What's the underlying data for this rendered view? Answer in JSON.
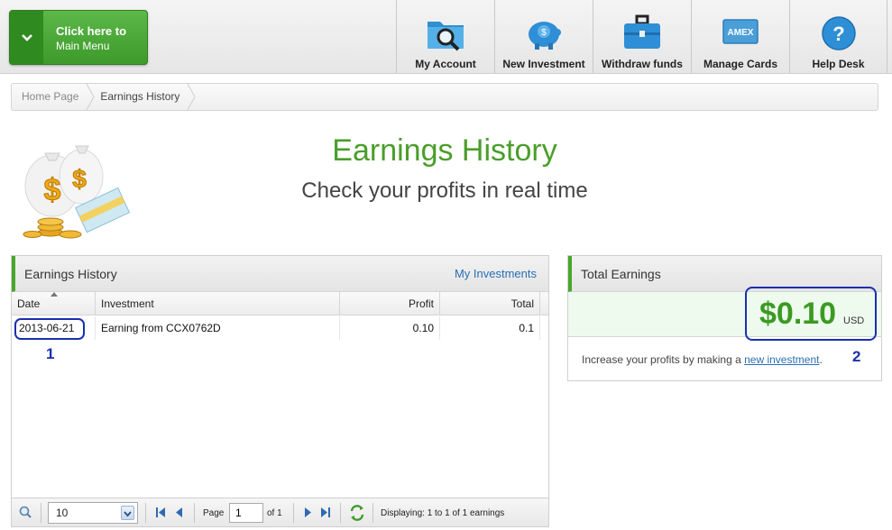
{
  "menu": {
    "line1": "Click here to",
    "line2": "Main Menu"
  },
  "nav": [
    {
      "label": "My Account",
      "icon": "magnifier-folder-icon"
    },
    {
      "label": "New Investment",
      "icon": "piggy-bank-icon"
    },
    {
      "label": "Withdraw funds",
      "icon": "briefcase-icon"
    },
    {
      "label": "Manage Cards",
      "icon": "credit-card-icon",
      "card_text": "AMEX"
    },
    {
      "label": "Help Desk",
      "icon": "help-icon",
      "glyph": "?"
    }
  ],
  "breadcrumb": [
    "Home Page",
    "Earnings History"
  ],
  "header": {
    "title": "Earnings History",
    "subtitle": "Check your profits in real time"
  },
  "history_panel": {
    "title": "Earnings History",
    "link": "My Investments",
    "columns": [
      "Date",
      "Investment",
      "Profit",
      "Total"
    ],
    "rows": [
      {
        "date": "2013-06-21",
        "investment": "Earning from CCX0762D",
        "profit": "0.10",
        "total": "0.1"
      }
    ],
    "annotation": "1",
    "pager": {
      "page_size": "10",
      "page_label": "Page",
      "page_value": "1",
      "of_label": "of 1",
      "status": "Displaying: 1 to 1 of 1 earnings"
    }
  },
  "total_panel": {
    "title": "Total Earnings",
    "amount": "$0.10",
    "currency": "USD",
    "note_prefix": "Increase your profits by making a ",
    "note_link": "new investment",
    "note_suffix": ".",
    "annotation": "2"
  },
  "colors": {
    "accent_green": "#4a9e2a",
    "link_blue": "#2a6fb6",
    "annotation_blue": "#1a2fb0"
  }
}
